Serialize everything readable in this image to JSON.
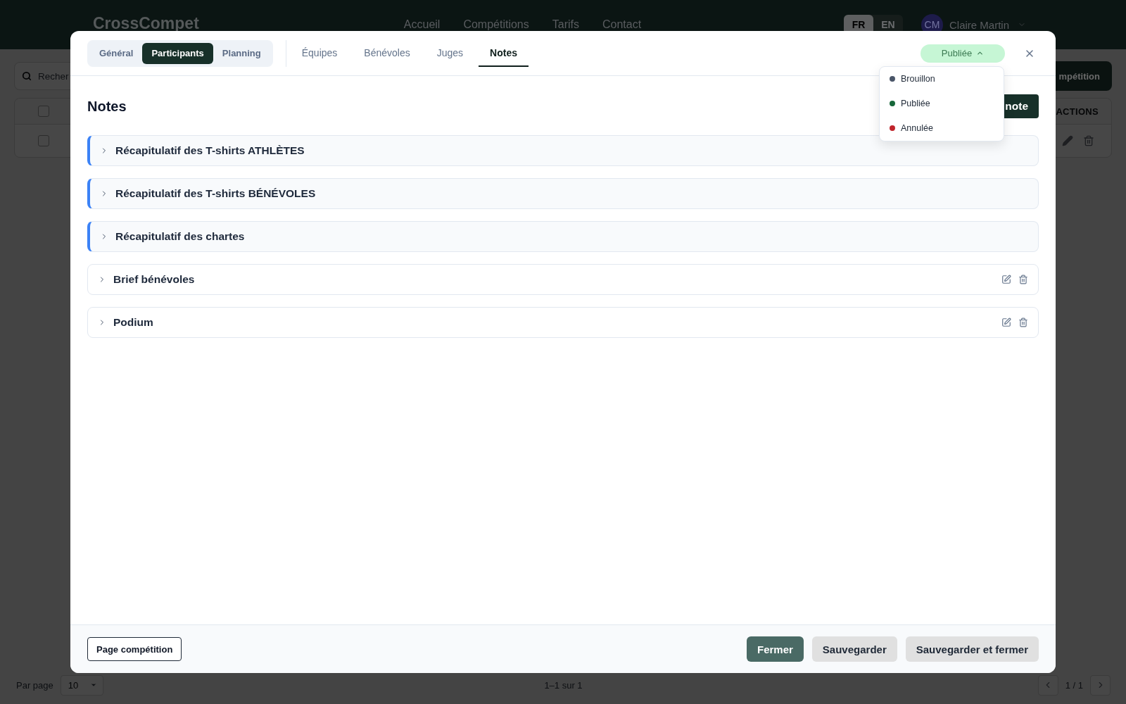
{
  "background": {
    "header": {
      "logo": "CrossCompet",
      "nav": [
        "Accueil",
        "Compétitions",
        "Tarifs",
        "Contact"
      ],
      "languages": [
        {
          "label": "FR",
          "selected": true
        },
        {
          "label": "EN",
          "selected": false
        }
      ],
      "user": {
        "initials": "CM",
        "name": "Claire Martin"
      }
    },
    "toolbar": {
      "search": {
        "placeholder": "Recher"
      },
      "create_button": "mpétition"
    },
    "table": {
      "header": {
        "checked": false,
        "actions_label": "ACTIONS"
      },
      "rows": [
        {
          "checked": false
        }
      ]
    },
    "pagination": {
      "per_page_label": "Par page",
      "per_page": "10",
      "range": "1–1 sur 1",
      "page": "1 / 1"
    }
  },
  "modal": {
    "sections": [
      {
        "label": "Général",
        "selected": false
      },
      {
        "label": "Participants",
        "selected": true
      },
      {
        "label": "Planning",
        "selected": false
      }
    ],
    "tabs": [
      {
        "label": "Équipes",
        "selected": false
      },
      {
        "label": "Bénévoles",
        "selected": false
      },
      {
        "label": "Juges",
        "selected": false
      },
      {
        "label": "Notes",
        "selected": true
      }
    ],
    "status": {
      "label": "Publiée",
      "expanded": true,
      "options": [
        {
          "label": "Brouillon",
          "color": "#4a5568"
        },
        {
          "label": "Publiée",
          "color": "#17673a"
        },
        {
          "label": "Annulée",
          "color": "#c0242b"
        }
      ]
    },
    "title": "Notes",
    "add_button": "note",
    "notes": [
      {
        "kind": "summary",
        "title": "Récapitulatif des T-shirts ATHLÈTES",
        "expanded": false
      },
      {
        "kind": "summary",
        "title": "Récapitulatif des T-shirts BÉNÉVOLES",
        "expanded": false
      },
      {
        "kind": "summary",
        "title": "Récapitulatif des chartes",
        "expanded": false
      },
      {
        "kind": "note",
        "title": "Brief bénévoles",
        "expanded": false
      },
      {
        "kind": "note",
        "title": "Podium",
        "expanded": false
      }
    ],
    "footer": {
      "page_button": "Page compétition",
      "buttons": [
        {
          "kind": "primary",
          "label": "Fermer"
        },
        {
          "kind": "secondary",
          "label": "Sauvegarder"
        },
        {
          "kind": "secondary",
          "label": "Sauvegarder et fermer"
        }
      ]
    }
  }
}
